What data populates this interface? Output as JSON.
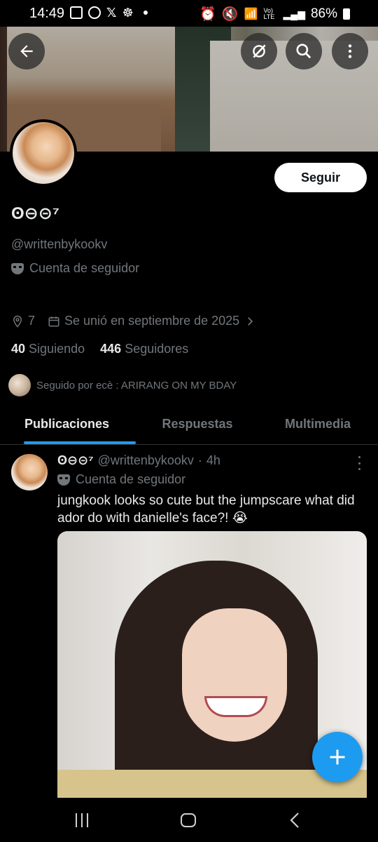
{
  "status_bar": {
    "time": "14:49",
    "battery": "86%",
    "network": "Vo) LTE",
    "icons": [
      "gallery-icon",
      "whatsapp-icon",
      "x-icon",
      "app-icon",
      "dot-icon",
      "alarm-icon",
      "mute-icon",
      "wifi-icon",
      "signal-icon",
      "battery-icon"
    ]
  },
  "header": {
    "buttons": [
      "back-icon",
      "grok-icon",
      "search-icon",
      "more-vertical-icon"
    ]
  },
  "profile": {
    "display_name": "ʘ⊖⊝⁷",
    "handle": "@writtenbykookv",
    "account_type": "Cuenta de seguidor",
    "follow_label": "Seguir",
    "location": "7",
    "joined": "Se unió en septiembre de 2025",
    "following_count": "40",
    "following_label": "Siguiendo",
    "followers_count": "446",
    "followers_label": "Seguidores",
    "followed_by": "Seguido por ecè : ARIRANG ON MY BDAY"
  },
  "tabs": [
    {
      "label": "Publicaciones",
      "active": true
    },
    {
      "label": "Respuestas",
      "active": false
    },
    {
      "label": "Multimedia",
      "active": false
    }
  ],
  "post": {
    "display_name": "ʘ⊖⊝⁷",
    "handle": "@writtenbykookv",
    "separator": "·",
    "time": "4h",
    "account_type": "Cuenta de seguidor",
    "text": "jungkook looks so cute but the jumpscare what did ador do with danielle's face?! 😭"
  },
  "colors": {
    "accent": "#1d9bf0",
    "background": "#000000",
    "muted_text": "#71767b",
    "primary_text": "#e7e9ea"
  }
}
